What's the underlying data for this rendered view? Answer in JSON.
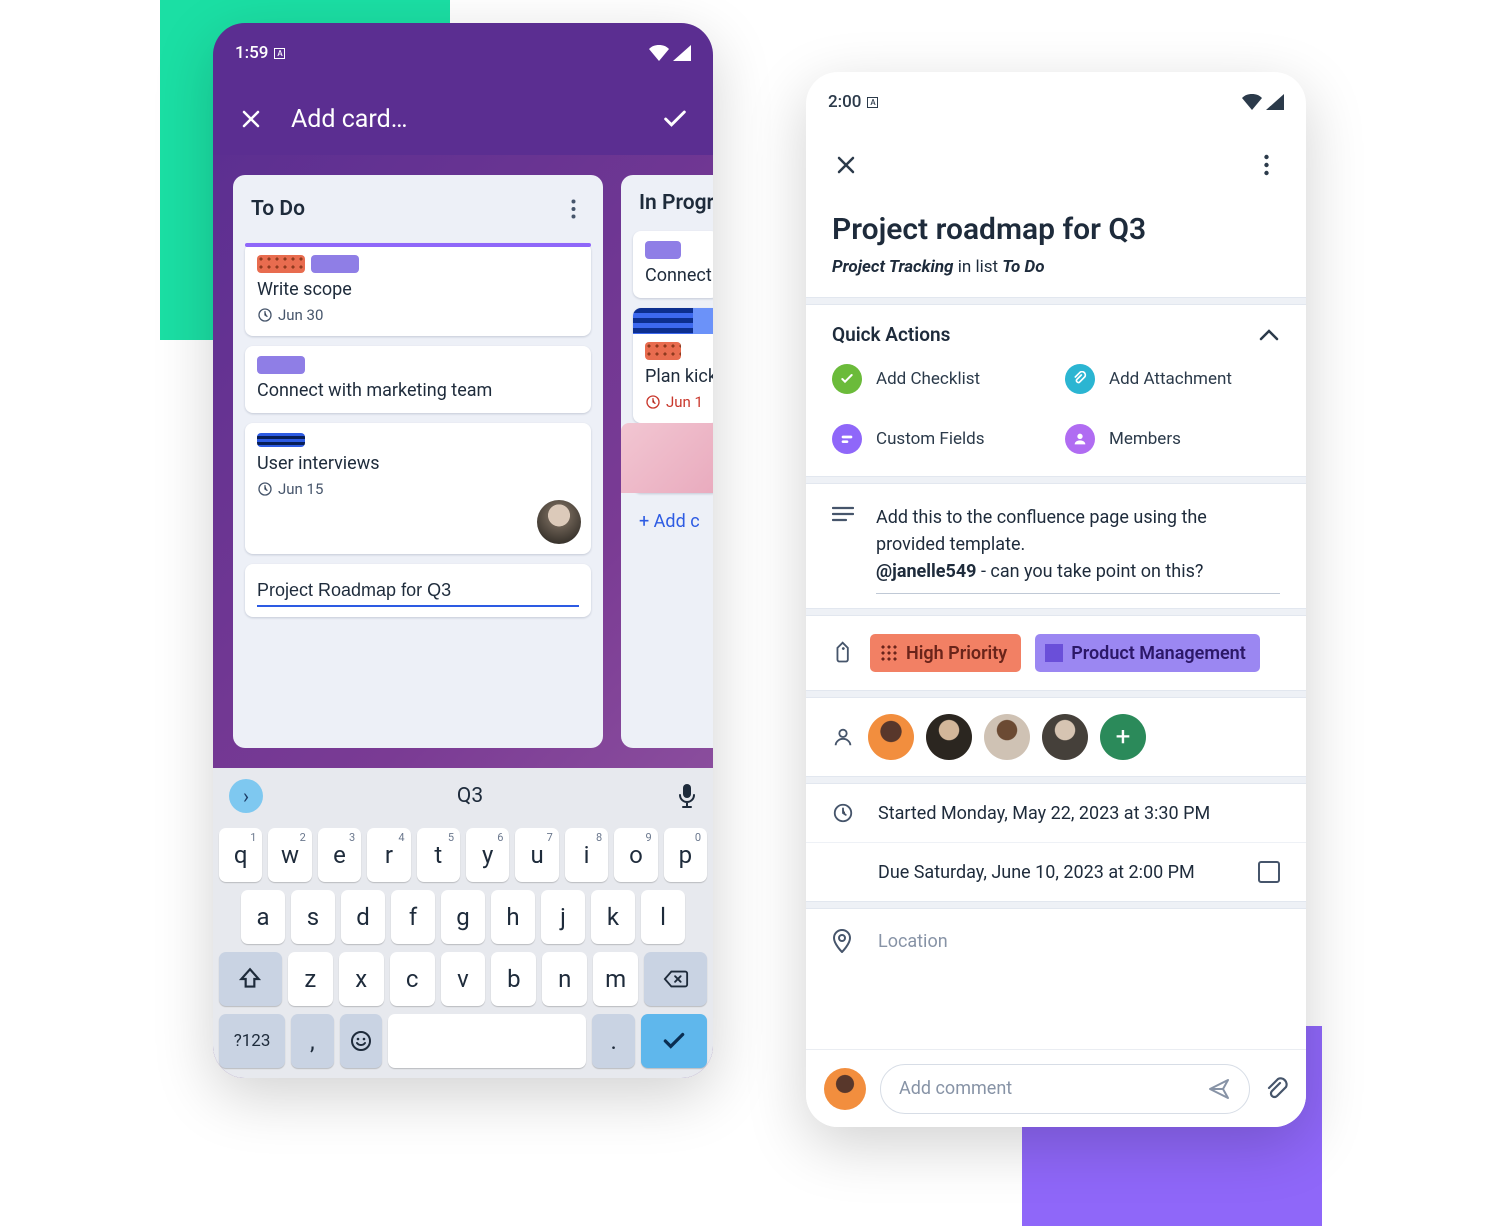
{
  "phone1": {
    "status": {
      "time": "1:59"
    },
    "header": {
      "title": "Add card…"
    },
    "lists": [
      {
        "title": "To Do",
        "cards": [
          {
            "name": "Write scope",
            "date": "Jun 30"
          },
          {
            "name": "Connect with marketing team"
          },
          {
            "name": "User interviews",
            "date": "Jun 15"
          }
        ],
        "newCard": "Project Roadmap for Q3"
      },
      {
        "title": "In Progress",
        "cards": [
          {
            "name": "Connect"
          },
          {
            "name": "Plan kick",
            "date": "Jun 1"
          }
        ],
        "addCard": "+ Add c"
      }
    ],
    "keyboard": {
      "suggestion": "Q3",
      "row1": [
        "q",
        "w",
        "e",
        "r",
        "t",
        "y",
        "u",
        "i",
        "o",
        "p"
      ],
      "row1sup": [
        "1",
        "2",
        "3",
        "4",
        "5",
        "6",
        "7",
        "8",
        "9",
        "0"
      ],
      "row2": [
        "a",
        "s",
        "d",
        "f",
        "g",
        "h",
        "j",
        "k",
        "l"
      ],
      "row3": [
        "z",
        "x",
        "c",
        "v",
        "b",
        "n",
        "m"
      ],
      "numKey": "?123",
      "comma": ",",
      "dot": "."
    }
  },
  "phone2": {
    "status": {
      "time": "2:00"
    },
    "title": "Project roadmap for Q3",
    "subtitle": {
      "board": "Project Tracking",
      "mid": "in list",
      "list": "To Do"
    },
    "quickActions": {
      "header": "Quick Actions",
      "items": [
        {
          "label": "Add Checklist"
        },
        {
          "label": "Add Attachment"
        },
        {
          "label": "Custom Fields"
        },
        {
          "label": "Members"
        }
      ]
    },
    "description": {
      "line1": "Add this to the confluence page using the provided template.",
      "mention": "@janelle549",
      "line2": " - can you take point on this?"
    },
    "labels": [
      {
        "text": "High Priority"
      },
      {
        "text": "Product Management"
      }
    ],
    "dates": {
      "started": "Started Monday, May 22, 2023 at 3:30 PM",
      "due": "Due Saturday, June 10, 2023 at 2:00 PM"
    },
    "location": "Location",
    "commentPlaceholder": "Add comment"
  }
}
